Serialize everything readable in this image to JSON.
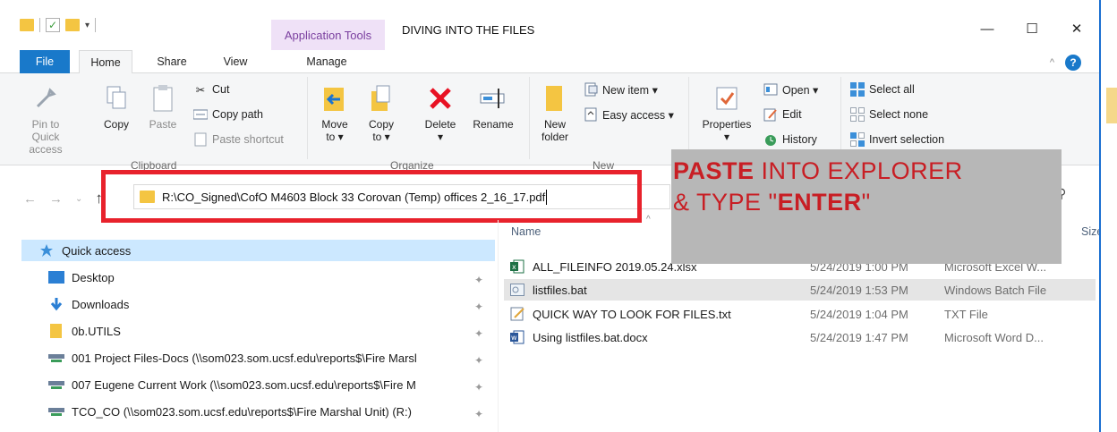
{
  "window": {
    "title": "DIVING INTO THE FILES",
    "context_tab": "Application Tools",
    "controls": {
      "minimize": "—",
      "maximize": "☐",
      "close": "✕"
    }
  },
  "tabs": [
    {
      "label": "File"
    },
    {
      "label": "Home"
    },
    {
      "label": "Share"
    },
    {
      "label": "View"
    },
    {
      "label": "Manage"
    }
  ],
  "ribbon": {
    "clipboard": {
      "pin_label_1": "Pin to Quick",
      "pin_label_2": "access",
      "copy": "Copy",
      "paste": "Paste",
      "cut": "Cut",
      "copy_path": "Copy path",
      "paste_shortcut": "Paste shortcut",
      "group": "Clipboard"
    },
    "organize": {
      "move_1": "Move",
      "move_2": "to ▾",
      "copy_1": "Copy",
      "copy_2": "to ▾",
      "delete_1": "Delete",
      "delete_2": "▾",
      "rename": "Rename",
      "group": "Organize"
    },
    "new": {
      "new_folder_1": "New",
      "new_folder_2": "folder",
      "new_item": "New item ▾",
      "easy_access": "Easy access ▾",
      "group": "New"
    },
    "open": {
      "properties_1": "Properties",
      "properties_2": "▾",
      "open": "Open ▾",
      "edit": "Edit",
      "history": "History"
    },
    "select": {
      "select_all": "Select all",
      "select_none": "Select none",
      "invert": "Invert selection"
    }
  },
  "address": {
    "path": "R:\\CO_Signed\\CofO M4603 Block 33 Corovan (Temp) offices 2_16_17.pdf"
  },
  "overlay": {
    "line1_bold": "PASTE",
    "line1_rest": " INTO EXPLORER",
    "line2_pre": "& TYPE \"",
    "line2_bold": "ENTER",
    "line2_post": "\""
  },
  "nav_pane": {
    "quick_access": "Quick access",
    "items": [
      {
        "label": "Desktop",
        "icon": "desktop-icon"
      },
      {
        "label": "Downloads",
        "icon": "downloads-icon"
      },
      {
        "label": "0b.UTILS",
        "icon": "folder-icon"
      },
      {
        "label": "001 Project Files-Docs (\\\\som023.som.ucsf.edu\\reports$\\Fire Marsl",
        "icon": "network-drive-icon"
      },
      {
        "label": "007 Eugene Current Work (\\\\som023.som.ucsf.edu\\reports$\\Fire M",
        "icon": "network-drive-icon"
      },
      {
        "label": "TCO_CO (\\\\som023.som.ucsf.edu\\reports$\\Fire Marshal Unit) (R:)",
        "icon": "network-drive-icon"
      }
    ]
  },
  "columns": {
    "name": "Name",
    "size": "Size"
  },
  "files": [
    {
      "name": "ALL_FILEINFO 2019.05.24.xlsx",
      "date": "5/24/2019 1:00 PM",
      "type": "Microsoft Excel W...",
      "icon": "excel-icon"
    },
    {
      "name": "listfiles.bat",
      "date": "5/24/2019 1:53 PM",
      "type": "Windows Batch File",
      "icon": "batch-file-icon"
    },
    {
      "name": "QUICK WAY TO LOOK FOR FILES.txt",
      "date": "5/24/2019 1:04 PM",
      "type": "TXT File",
      "icon": "text-file-icon"
    },
    {
      "name": "Using listfiles.bat.docx",
      "date": "5/24/2019 1:47 PM",
      "type": "Microsoft Word D...",
      "icon": "word-icon"
    }
  ],
  "colors": {
    "file_tab": "#1979ca",
    "context_tab_bg": "#efe1f7",
    "context_tab_text": "#7a3f9f",
    "highlight_box": "#e8222c",
    "overlay_bg": "#b7b7b7",
    "overlay_text": "#c81e24",
    "selected_row": "#e5e5e5",
    "quick_access_bg": "#cce8ff"
  }
}
